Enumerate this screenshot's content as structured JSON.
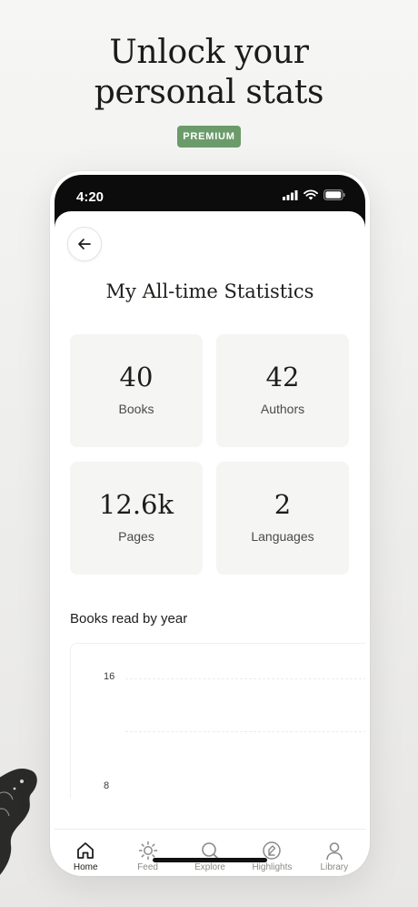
{
  "hero": {
    "headline_line1": "Unlock your",
    "headline_line2": "personal stats",
    "badge": "PREMIUM",
    "badge_color": "#6b9b6a"
  },
  "status_bar": {
    "time": "4:20",
    "icons": [
      "signal-icon",
      "wifi-icon",
      "battery-icon"
    ]
  },
  "screen": {
    "back_icon": "arrow-left-icon",
    "title": "My All-time Statistics",
    "stats": [
      {
        "value": "40",
        "label": "Books"
      },
      {
        "value": "42",
        "label": "Authors"
      },
      {
        "value": "12.6k",
        "label": "Pages"
      },
      {
        "value": "2",
        "label": "Languages"
      }
    ]
  },
  "chart_data": {
    "type": "bar",
    "title": "Books read by year",
    "y_ticks": [
      "16",
      "8"
    ],
    "xlabel": "",
    "ylabel": "",
    "categories": [],
    "values": []
  },
  "tabbar": {
    "items": [
      {
        "label": "Home",
        "icon": "home-icon",
        "active": true
      },
      {
        "label": "Feed",
        "icon": "sun-icon",
        "active": false
      },
      {
        "label": "Explore",
        "icon": "search-icon",
        "active": false
      },
      {
        "label": "Highlights",
        "icon": "highlight-icon",
        "active": false
      },
      {
        "label": "Library",
        "icon": "person-icon",
        "active": false
      }
    ]
  }
}
